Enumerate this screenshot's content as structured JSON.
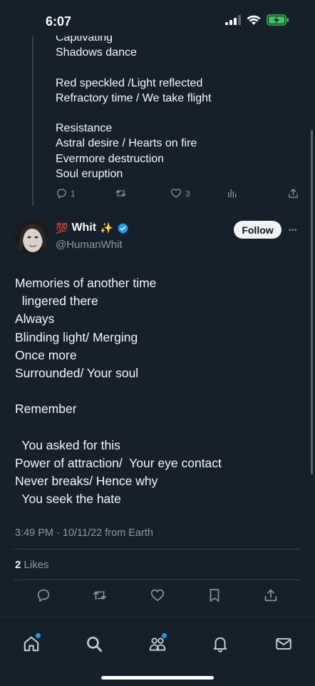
{
  "status_bar": {
    "time": "6:07"
  },
  "prev_tweet": {
    "text": "Captivating\nShadows dance\n\nRed speckled /Light reflected\nRefractory time / We take flight\n\nResistance\nAstral desire / Hearts on fire\nEvermore destruction\nSoul eruption",
    "reply_count": "1",
    "like_count": "3"
  },
  "author": {
    "emoji_prefix": "💯",
    "name": "Whit",
    "emoji_suffix": "✨",
    "handle": "@HumanWhit",
    "follow_label": "Follow",
    "more_label": "•••"
  },
  "tweet": {
    "text": "Memories of another time\n  lingered there\nAlways\nBlinding light/ Merging\nOnce more\nSurrounded/ Your soul\n\nRemember\n\n  You asked for this\nPower of attraction/  Your eye contact\nNever breaks/ Hence why\n  You seek the hate",
    "timestamp": "3:49 PM · 10/11/22 from Earth",
    "likes_count": "2",
    "likes_label": "Likes"
  },
  "colors": {
    "background": "#15202b",
    "accent": "#1d9bf0",
    "muted": "#8b98a5"
  },
  "icons": [
    "reply-icon",
    "retweet-icon",
    "like-icon",
    "views-icon",
    "share-icon",
    "bookmark-icon",
    "home-icon",
    "search-icon",
    "communities-icon",
    "notifications-icon",
    "messages-icon"
  ]
}
